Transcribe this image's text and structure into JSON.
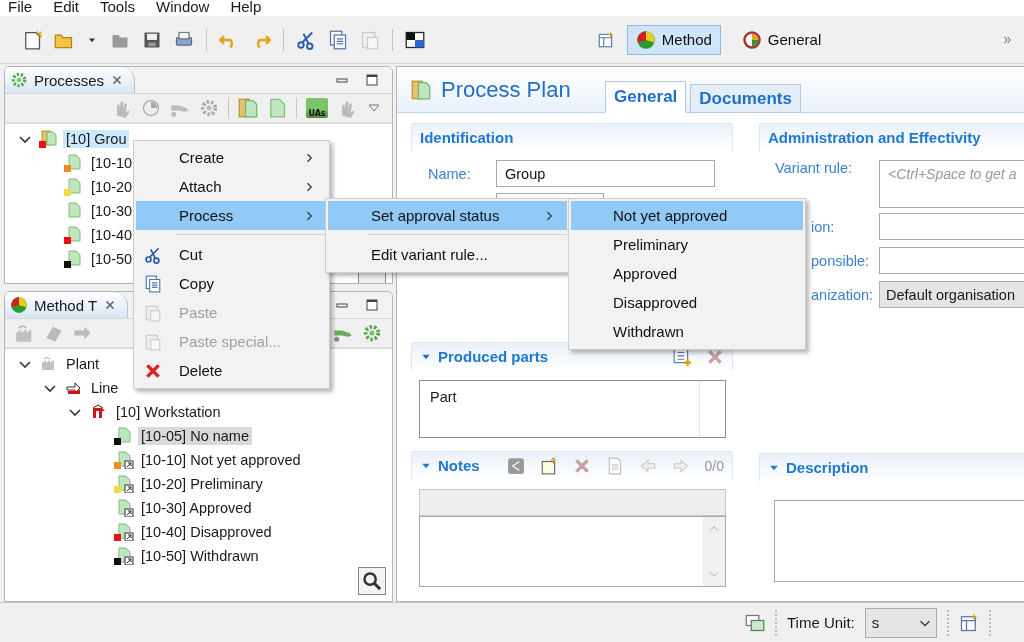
{
  "menubar": [
    "File",
    "Edit",
    "Tools",
    "Window",
    "Help"
  ],
  "perspectives": [
    {
      "label": "Method",
      "selected": true
    },
    {
      "label": "General",
      "selected": false
    }
  ],
  "processes_panel": {
    "title": "Processes",
    "uas_label": "UAs",
    "tree": [
      {
        "label": "[10] Grou",
        "kind": "group",
        "color": "#e81010",
        "selected": true,
        "expanded": true,
        "children": [
          {
            "label": "[10-10",
            "kind": "process",
            "color": "#f08a24",
            "selected": false
          },
          {
            "label": "[10-20",
            "kind": "process",
            "color": "#f2dc3c",
            "selected": false
          },
          {
            "label": "[10-30",
            "kind": "process",
            "selected": false
          },
          {
            "label": "[10-40",
            "kind": "process",
            "color": "#e81010",
            "selected": false
          },
          {
            "label": "[10-50",
            "kind": "process",
            "color": "#111111",
            "selected": false
          }
        ]
      }
    ]
  },
  "method_panel": {
    "title": "Method T",
    "tree": [
      {
        "label": "Plant",
        "kind": "plant",
        "selected": false,
        "expanded": true,
        "children": [
          {
            "label": "Line",
            "kind": "line",
            "selected": false,
            "expanded": true,
            "children": [
              {
                "label": "[10] Workstation",
                "kind": "workstation",
                "selected": false,
                "expanded": true,
                "children": [
                  {
                    "label": "[10-05] No name",
                    "kind": "process",
                    "color": "#111111",
                    "selected": true
                  },
                  {
                    "label": "[10-10] Not yet approved",
                    "kind": "reference",
                    "color": "#f08a24",
                    "selected": false
                  },
                  {
                    "label": "[10-20] Preliminary",
                    "kind": "reference",
                    "color": "#f2dc3c",
                    "selected": false
                  },
                  {
                    "label": "[10-30] Approved",
                    "kind": "reference",
                    "selected": false
                  },
                  {
                    "label": "[10-40] Disapproved",
                    "kind": "reference",
                    "color": "#e81010",
                    "selected": false
                  },
                  {
                    "label": "[10-50] Withdrawn",
                    "kind": "reference",
                    "color": "#111111",
                    "selected": false
                  }
                ]
              }
            ]
          }
        ]
      }
    ]
  },
  "editor": {
    "title": "Process Plan",
    "tabs": [
      {
        "label": "General",
        "selected": true
      },
      {
        "label": "Documents",
        "selected": false
      }
    ],
    "identification": {
      "title": "Identification",
      "name_label": "Name:",
      "name_value": "Group"
    },
    "administration": {
      "title": "Administration and Effectivity",
      "variant_label": "Variant rule:",
      "variant_placeholder": "<Ctrl+Space to get a",
      "rows": [
        {
          "label": "ion:",
          "kind": "text"
        },
        {
          "label": "ponsible:",
          "kind": "text"
        },
        {
          "label": "anization:",
          "kind": "combo",
          "value": "Default organisation"
        }
      ]
    },
    "produced_parts": {
      "title": "Produced parts",
      "expanded": true,
      "items": [
        "Part"
      ]
    },
    "notes": {
      "title": "Notes",
      "expanded": true,
      "counter": "0/0"
    },
    "description": {
      "title": "Description",
      "expanded": true
    }
  },
  "status_bar": {
    "time_unit_label": "Time Unit:",
    "time_unit_value": "s"
  },
  "context_menu": {
    "items": [
      {
        "label": "Create",
        "kind": "submenu",
        "selected": false,
        "disabled": false
      },
      {
        "label": "Attach",
        "kind": "submenu",
        "selected": false,
        "disabled": false
      },
      {
        "label": "Process",
        "kind": "submenu",
        "selected": true,
        "disabled": false
      },
      {
        "label": "Cut",
        "kind": "action",
        "separator_before": true,
        "selected": false,
        "disabled": false
      },
      {
        "label": "Copy",
        "kind": "action",
        "selected": false,
        "disabled": false
      },
      {
        "label": "Paste",
        "kind": "action",
        "selected": false,
        "disabled": true
      },
      {
        "label": "Paste special...",
        "kind": "action",
        "selected": false,
        "disabled": true
      },
      {
        "label": "Delete",
        "kind": "action",
        "selected": false,
        "disabled": false
      }
    ]
  },
  "process_submenu": {
    "items": [
      {
        "label": "Set approval status",
        "kind": "submenu",
        "selected": true,
        "disabled": false
      },
      {
        "label": "Edit variant rule...",
        "kind": "action",
        "separator_before": true,
        "selected": false,
        "disabled": false
      }
    ]
  },
  "approval_submenu": {
    "items": [
      {
        "label": "Not yet approved",
        "selected": true,
        "disabled": false
      },
      {
        "label": "Preliminary",
        "selected": false,
        "disabled": false
      },
      {
        "label": "Approved",
        "selected": false,
        "disabled": false
      },
      {
        "label": "Disapproved",
        "selected": false,
        "disabled": false
      },
      {
        "label": "Withdrawn",
        "selected": false,
        "disabled": false
      }
    ]
  }
}
